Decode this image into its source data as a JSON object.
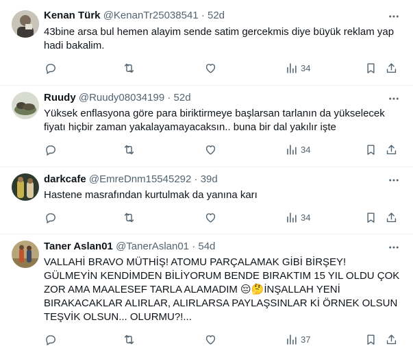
{
  "tweets": [
    {
      "name": "Kenan Türk",
      "handle": "@KenanTr25038541",
      "dot": "·",
      "time": "52d",
      "text": "43bine arsa bul hemen alayim sende satim gercekmis diye büyük reklam yap hadi bakalim.",
      "views": "34"
    },
    {
      "name": "Ruudy",
      "handle": "@Ruudy08034199",
      "dot": "·",
      "time": "52d",
      "text": "Yüksek enflasyona göre para biriktirmeye başlarsan tarlanın da yükselecek fiyatı hiçbir zaman yakalayamayacaksın.. buna bir dal yakılır işte",
      "views": "34"
    },
    {
      "name": "darkcafe",
      "handle": "@EmreDnm15545292",
      "dot": "·",
      "time": "39d",
      "text": "Hastene masrafından kurtulmak da yanına karı",
      "views": "34"
    },
    {
      "name": "Taner Aslan01",
      "handle": "@TanerAslan01",
      "dot": "·",
      "time": "54d",
      "text": "VALLAHİ BRAVO MÜTHİŞ! ATOMU PARÇALAMAK GİBİ BİRŞEY! GÜLMEYİN KENDİMDEN BİLİYORUM BENDE BIRAKTIM 15 YIL OLDU ÇOK ZOR AMA MAALESEF TARLA ALAMADIM 😔🤔İNŞALLAH YENİ BIRAKACAKLAR ALIRLAR, ALIRLARSA PAYLAŞSINLAR Kİ ÖRNEK OLSUN TEŞVİK OLSUN... OLURMU?!...",
      "views": "37"
    }
  ],
  "icons": {
    "reply": "reply-icon",
    "retweet": "retweet-icon",
    "like": "like-icon",
    "views": "views-icon",
    "bookmark": "bookmark-icon",
    "share": "share-icon",
    "more": "more-icon"
  },
  "colors": {
    "text": "#0f1419",
    "secondary": "#536471",
    "divider": "#eff3f4"
  }
}
